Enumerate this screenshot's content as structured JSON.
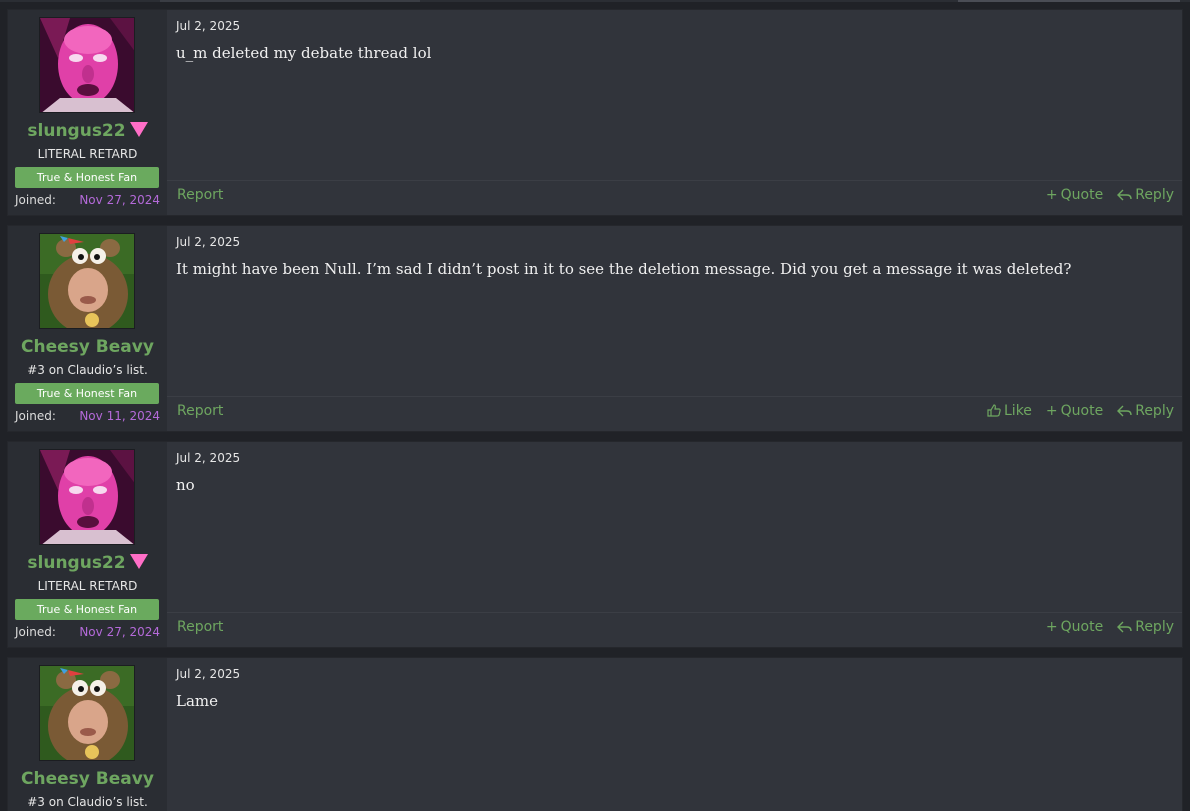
{
  "posts": [
    {
      "date": "Jul 2, 2025",
      "message": "u_m deleted my debate thread lol",
      "user": {
        "name": "slungus22",
        "title": "LITERAL RETARD",
        "banner": "True & Honest Fan",
        "joined_label": "Joined:",
        "joined_date": "Nov 27, 2024",
        "avatar": "pink-face-avatar"
      },
      "report": "Report",
      "actions": {
        "quote": "Quote",
        "reply": "Reply"
      }
    },
    {
      "date": "Jul 2, 2025",
      "message": "It might have been Null. I’m sad I didn’t post in it to see the deletion message. Did you get a message it was deleted?",
      "user": {
        "name": "Cheesy Beavy",
        "title": "#3 on Claudio’s list.",
        "banner": "True & Honest Fan",
        "joined_label": "Joined:",
        "joined_date": "Nov 11, 2024",
        "avatar": "beaver-costume-avatar"
      },
      "report": "Report",
      "actions": {
        "like": "Like",
        "quote": "Quote",
        "reply": "Reply"
      }
    },
    {
      "date": "Jul 2, 2025",
      "message": "no",
      "user": {
        "name": "slungus22",
        "title": "LITERAL RETARD",
        "banner": "True & Honest Fan",
        "joined_label": "Joined:",
        "joined_date": "Nov 27, 2024",
        "avatar": "pink-face-avatar"
      },
      "report": "Report",
      "actions": {
        "quote": "Quote",
        "reply": "Reply"
      }
    },
    {
      "date": "Jul 2, 2025",
      "message": "Lame",
      "user": {
        "name": "Cheesy Beavy",
        "title": "#3 on Claudio’s list.",
        "avatar": "beaver-costume-avatar"
      }
    }
  ],
  "colors": {
    "username": "#6ea660",
    "link": "#6ea660",
    "joined_date": "#b46ad9",
    "banner": "#6aaa5e",
    "user_marker": "#ff6ec7",
    "post_bg": "#31343b",
    "user_cell_bg": "#2a2d33"
  }
}
